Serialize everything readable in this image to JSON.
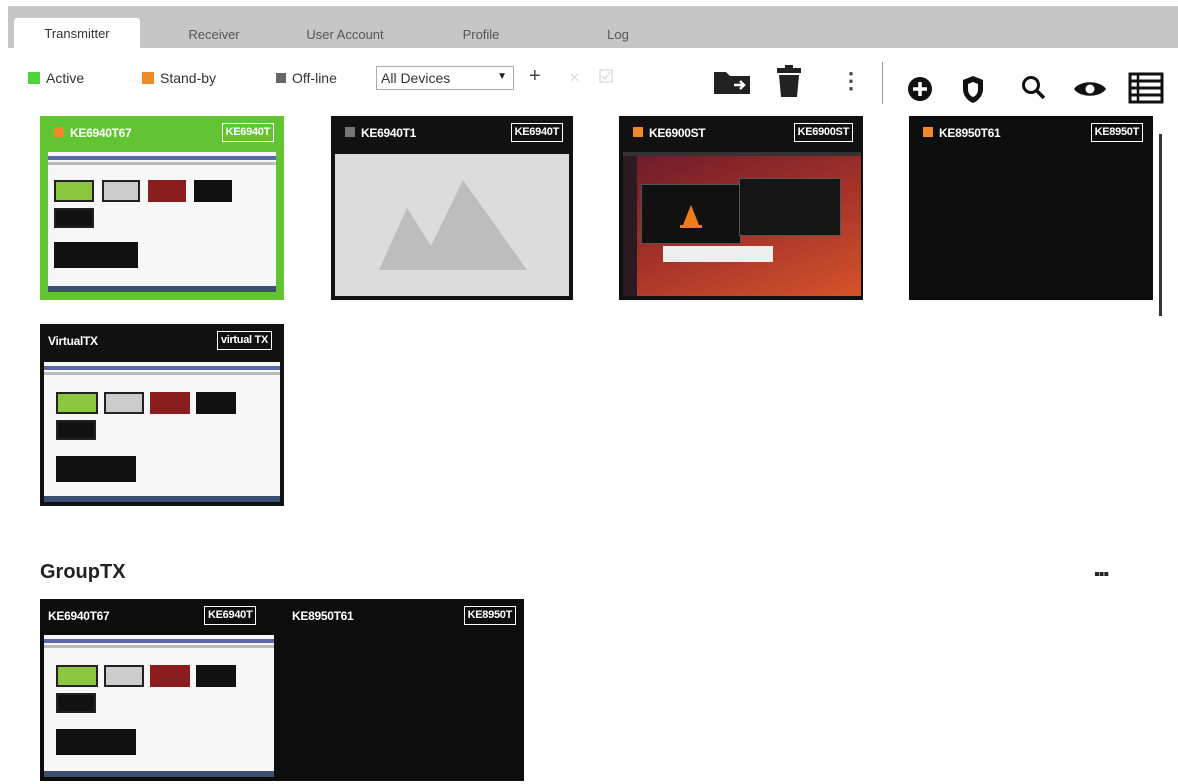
{
  "tabs": [
    {
      "label": "Transmitter",
      "active": true
    },
    {
      "label": "Receiver",
      "active": false
    },
    {
      "label": "User Account",
      "active": false
    },
    {
      "label": "Profile",
      "active": false
    },
    {
      "label": "Log",
      "active": false
    }
  ],
  "legend": {
    "active": {
      "label": "Active",
      "color": "#4cd43a"
    },
    "standby": {
      "label": "Stand-by",
      "color": "#f08a28"
    },
    "offline": {
      "label": "Off-line",
      "color": "#666666"
    }
  },
  "filter": {
    "selected": "All Devices",
    "caret": "▼"
  },
  "toolbar": {
    "add_glyph": "+",
    "more_glyph": "⋮",
    "icons": [
      "plus-icon",
      "delete-x-icon",
      "checkbox-icon",
      "move-to-folder-icon",
      "trash-icon",
      "vertical-more-icon",
      "add-circle-icon",
      "shield-icon",
      "search-icon",
      "eye-icon",
      "list-view-icon"
    ]
  },
  "devices": [
    {
      "name": "KE6940T67",
      "badge": "KE6940T",
      "status": "active",
      "preview": "desktop"
    },
    {
      "name": "KE6940T1",
      "badge": "KE6940T",
      "status": "offline",
      "preview": "placeholder"
    },
    {
      "name": "KE6900ST",
      "badge": "KE6900ST",
      "status": "standby",
      "preview": "linux-desktop"
    },
    {
      "name": "KE8950T61",
      "badge": "KE8950T",
      "status": "standby",
      "preview": "black"
    },
    {
      "name": "VirtualTX",
      "badge": "virtual TX",
      "status": "none",
      "preview": "desktop"
    }
  ],
  "group": {
    "title": "GroupTX",
    "more": "▪▪▪",
    "members": [
      {
        "name": "KE6940T67",
        "badge": "KE6940T",
        "preview": "desktop"
      },
      {
        "name": "KE8950T61",
        "badge": "KE8950T",
        "preview": "black"
      }
    ]
  }
}
